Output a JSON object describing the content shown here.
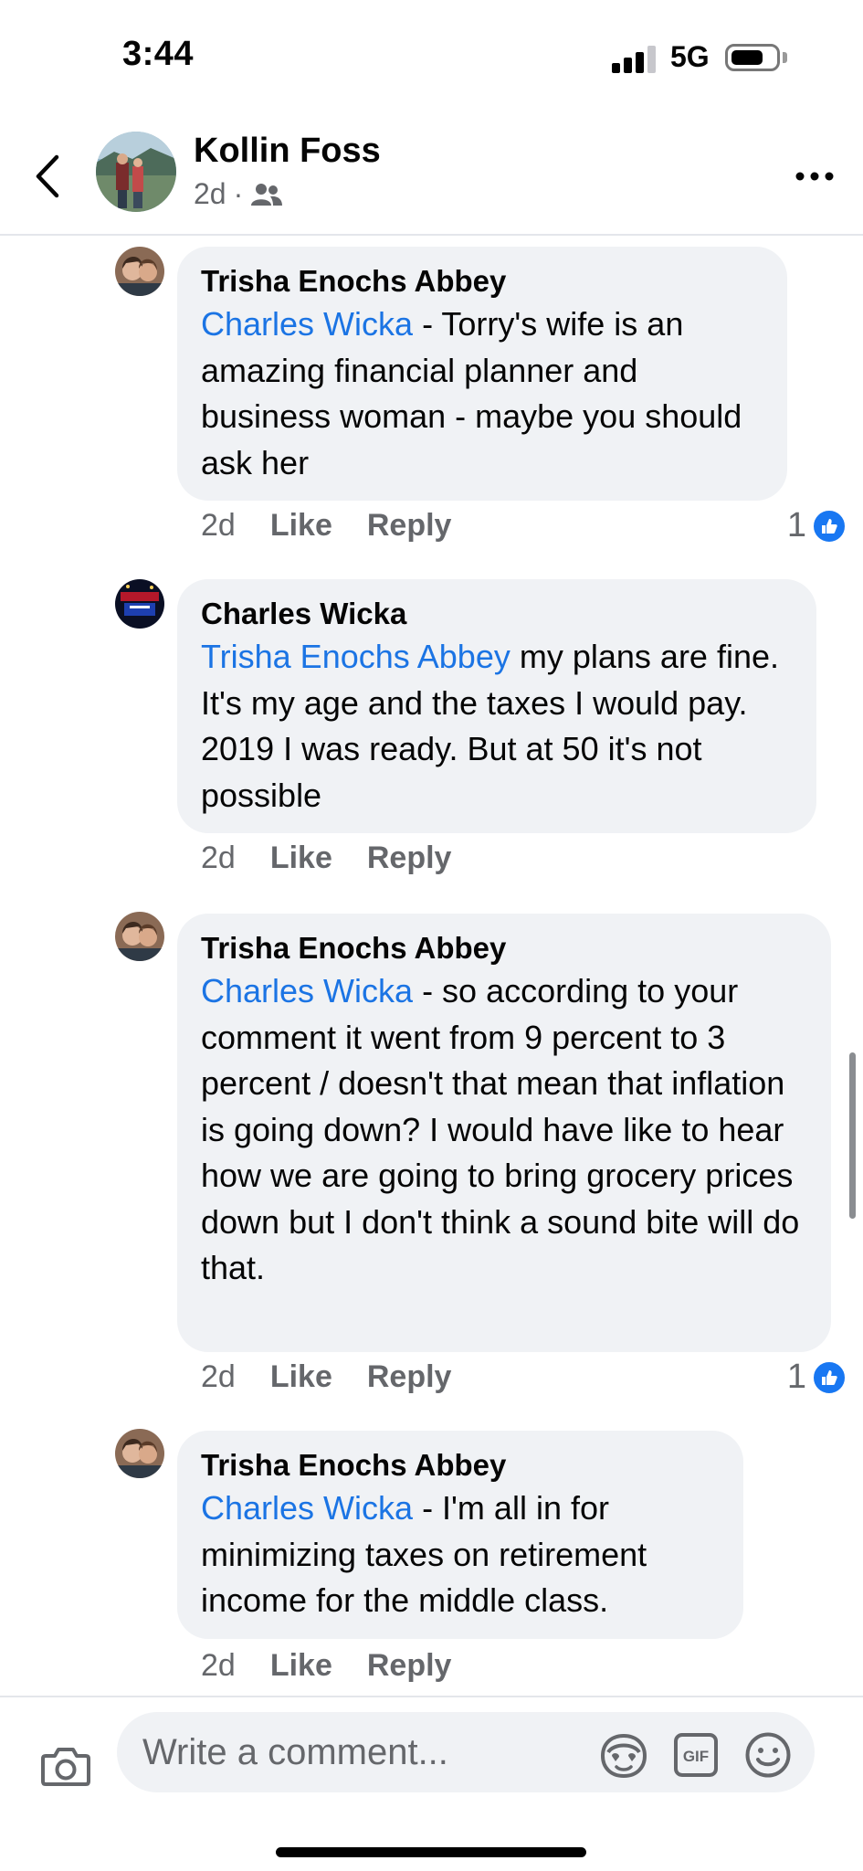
{
  "status_bar": {
    "time": "3:44",
    "network": "5G"
  },
  "header": {
    "name": "Kollin Foss",
    "meta_time": "2d",
    "meta_dot": "·",
    "back_icon": "chevron-left-icon",
    "more_icon": "more-horizontal-icon",
    "audience_icon": "friends-icon"
  },
  "comments": [
    {
      "author": "Trisha Enochs Abbey",
      "mention": "Charles Wicka",
      "text": " - Torry's wife is an amazing financial planner and business woman - maybe you should ask her",
      "time": "2d",
      "like_label": "Like",
      "reply_label": "Reply",
      "reaction_count": "1"
    },
    {
      "author": "Charles Wicka",
      "mention": "Trisha Enochs Abbey",
      "text": " my plans are fine. It's my age and the taxes I would pay. 2019 I was ready. But at 50 it's not possible",
      "time": "2d",
      "like_label": "Like",
      "reply_label": "Reply"
    },
    {
      "author": "Trisha Enochs Abbey",
      "mention": "Charles Wicka",
      "text": " - so according to your comment it went from 9 percent to 3 percent / doesn't that mean that inflation is going down?  I would have like to hear how we are going to bring grocery prices down but I don't think a sound bite will do that.",
      "time": "2d",
      "like_label": "Like",
      "reply_label": "Reply",
      "reaction_count": "1"
    },
    {
      "author": "Trisha Enochs Abbey",
      "mention": "Charles Wicka",
      "text": " - I'm all in for minimizing taxes on retirement income for the middle class.",
      "time": "2d",
      "like_label": "Like",
      "reply_label": "Reply"
    }
  ],
  "composer": {
    "placeholder": "Write a comment...",
    "camera_icon": "camera-icon",
    "avatar_icon": "avatar-sticker-icon",
    "gif_label": "GIF",
    "emoji_icon": "smiley-icon"
  },
  "colors": {
    "link": "#1b74e4",
    "bubble": "#f0f2f5",
    "muted": "#65676b",
    "like_blue": "#1877f2"
  }
}
